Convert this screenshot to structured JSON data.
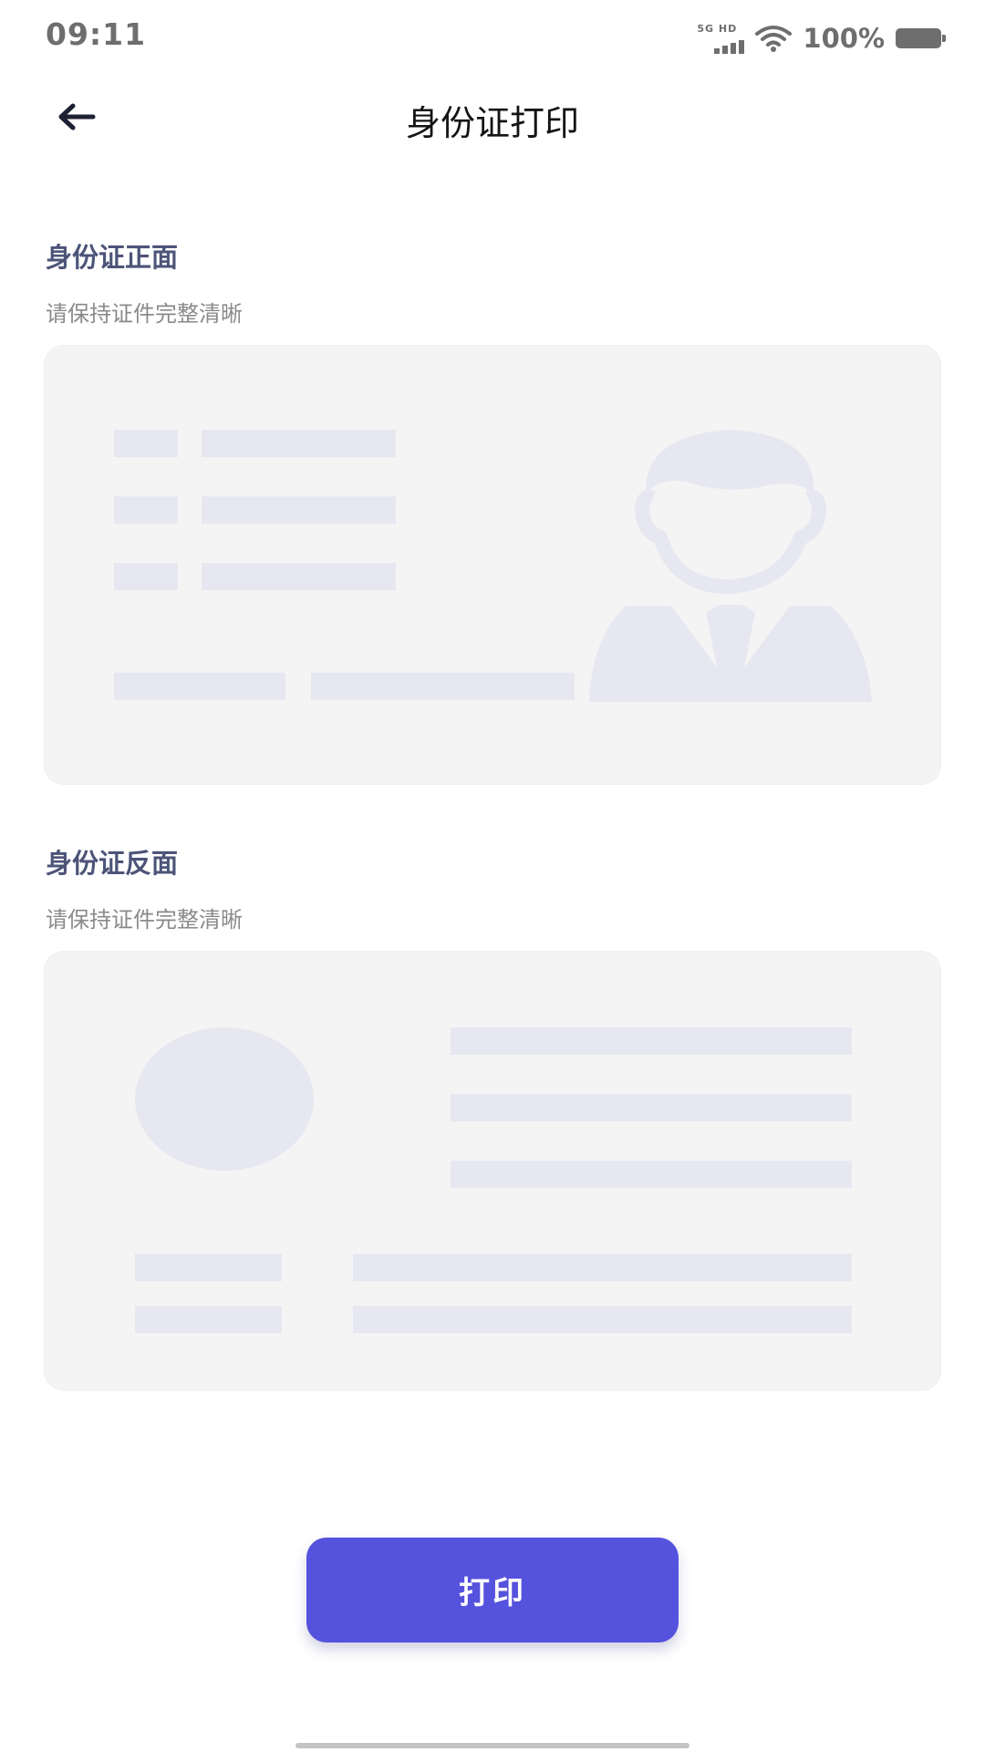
{
  "status_bar": {
    "time": "09:11",
    "network_label": "5G HD",
    "battery": "100%"
  },
  "header": {
    "title": "身份证打印",
    "back_icon": "arrow-left-icon"
  },
  "front": {
    "title": "身份证正面",
    "hint": "请保持证件完整清晰"
  },
  "back": {
    "title": "身份证反面",
    "hint": "请保持证件完整清晰"
  },
  "print_button": {
    "label": "打印"
  },
  "colors": {
    "accent": "#5552dd",
    "section_title": "#4c5478",
    "placeholder": "#e7e7f1",
    "card_bg": "#f4f4f4"
  }
}
